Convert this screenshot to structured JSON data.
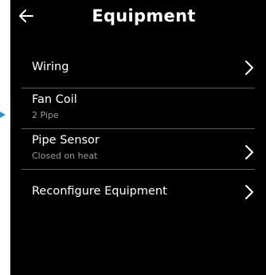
{
  "header": {
    "title": "Equipment",
    "back_icon": "back-arrow-icon"
  },
  "rows": [
    {
      "label": "Wiring",
      "sublabel": "",
      "chevron": true
    },
    {
      "label": "Fan Coil",
      "sublabel": "2 Pipe",
      "chevron": false
    },
    {
      "label": "Pipe Sensor",
      "sublabel": "Closed on heat",
      "chevron": true
    },
    {
      "label": "Reconfigure Equipment",
      "sublabel": "",
      "chevron": true
    }
  ],
  "colors": {
    "background": "#000000",
    "text": "#ffffff",
    "subtext": "#9a9a9a",
    "divider": "#5a5a5a",
    "indicator": "#2d8fd6"
  }
}
